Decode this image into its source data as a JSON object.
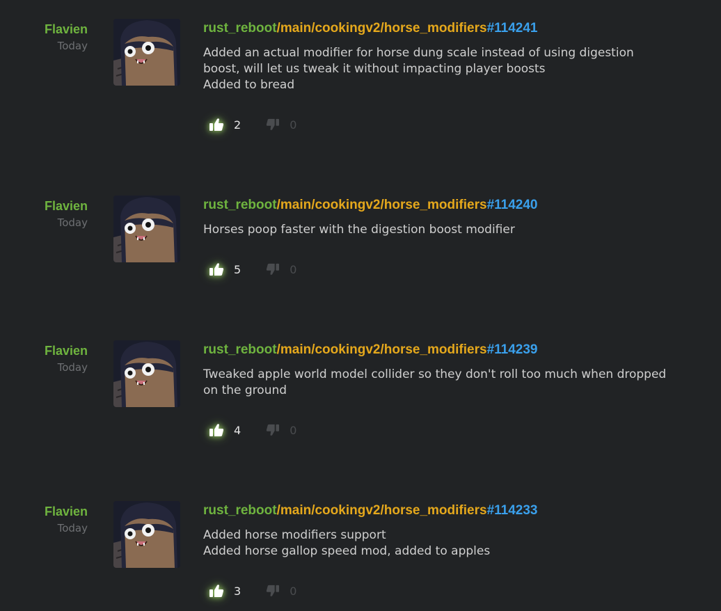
{
  "commits": [
    {
      "author": "Flavien",
      "time": "Today",
      "repo": "rust_reboot",
      "branch": "/main/cookingv2/horse_modifiers",
      "changeset": "#114241",
      "message": [
        "Added an actual modifier for horse dung scale instead of using digestion",
        "boost, will let us tweak it without impacting player boosts",
        "Added to bread"
      ],
      "likes": "2",
      "dislikes": "0"
    },
    {
      "author": "Flavien",
      "time": "Today",
      "repo": "rust_reboot",
      "branch": "/main/cookingv2/horse_modifiers",
      "changeset": "#114240",
      "message": [
        "Horses poop faster with the digestion boost modifier"
      ],
      "likes": "5",
      "dislikes": "0"
    },
    {
      "author": "Flavien",
      "time": "Today",
      "repo": "rust_reboot",
      "branch": "/main/cookingv2/horse_modifiers",
      "changeset": "#114239",
      "message": [
        "Tweaked apple world model collider so they don't roll too much when dropped",
        "on the ground"
      ],
      "likes": "4",
      "dislikes": "0"
    },
    {
      "author": "Flavien",
      "time": "Today",
      "repo": "rust_reboot",
      "branch": "/main/cookingv2/horse_modifiers",
      "changeset": "#114233",
      "message": [
        "Added horse modifiers support",
        "Added horse gallop speed mod, added to apples"
      ],
      "likes": "3",
      "dislikes": "0"
    }
  ],
  "icons": {
    "like": "thumbs-up-icon",
    "dislike": "thumbs-down-icon",
    "avatar": "cartoon-character-avatar"
  },
  "colors": {
    "background": "#212325",
    "author": "#6fb43f",
    "repo": "#6fb43f",
    "branch": "#e5a81c",
    "changeset": "#3aa0ec",
    "muted": "#6e7073"
  }
}
